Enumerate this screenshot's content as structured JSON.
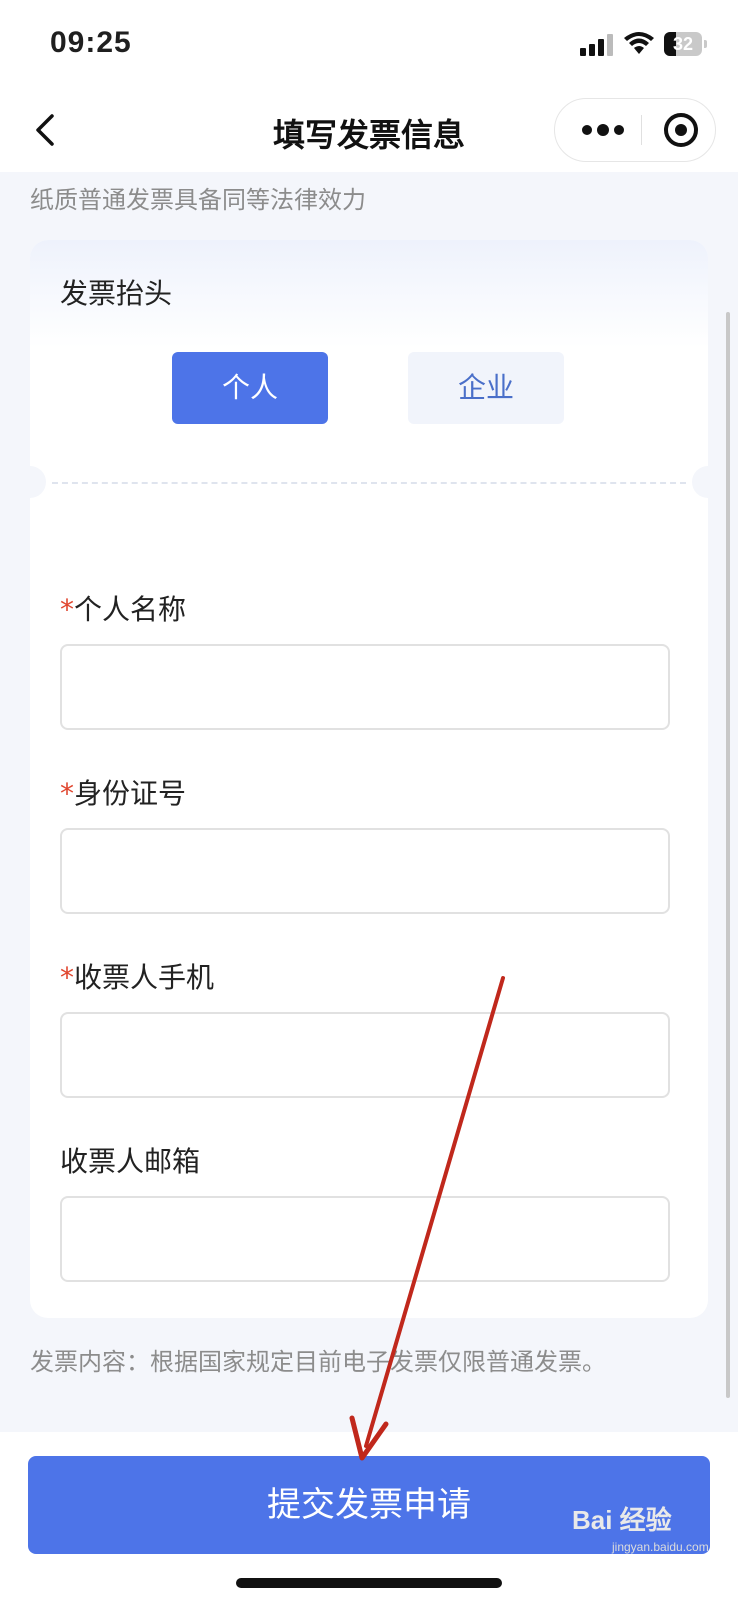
{
  "status_bar": {
    "time": "09:25",
    "battery_level": "32"
  },
  "nav": {
    "title": "填写发票信息",
    "back_icon": "chevron-left-icon",
    "more_icon": "more-dots-icon",
    "target_icon": "target-icon"
  },
  "notice_text": "纸质普通发票具备同等法律效力",
  "invoice_header": {
    "title": "发票抬头",
    "options": [
      "个人",
      "企业"
    ],
    "selected": "个人"
  },
  "fields": [
    {
      "label": "个人名称",
      "required": "*",
      "value": ""
    },
    {
      "label": "身份证号",
      "required": "*",
      "value": ""
    },
    {
      "label": "收票人手机",
      "required": "*",
      "value": ""
    },
    {
      "label": "收票人邮箱",
      "required": "",
      "value": ""
    }
  ],
  "footer_note": "发票内容：根据国家规定目前电子发票仅限普通发票。",
  "submit_label": "提交发票申请",
  "watermark": {
    "main": "Bai 经验",
    "sub": "jingyan.baidu.com"
  },
  "colors": {
    "accent": "#4d74e8",
    "required": "#e0462f",
    "annotation": "#c0281c"
  }
}
